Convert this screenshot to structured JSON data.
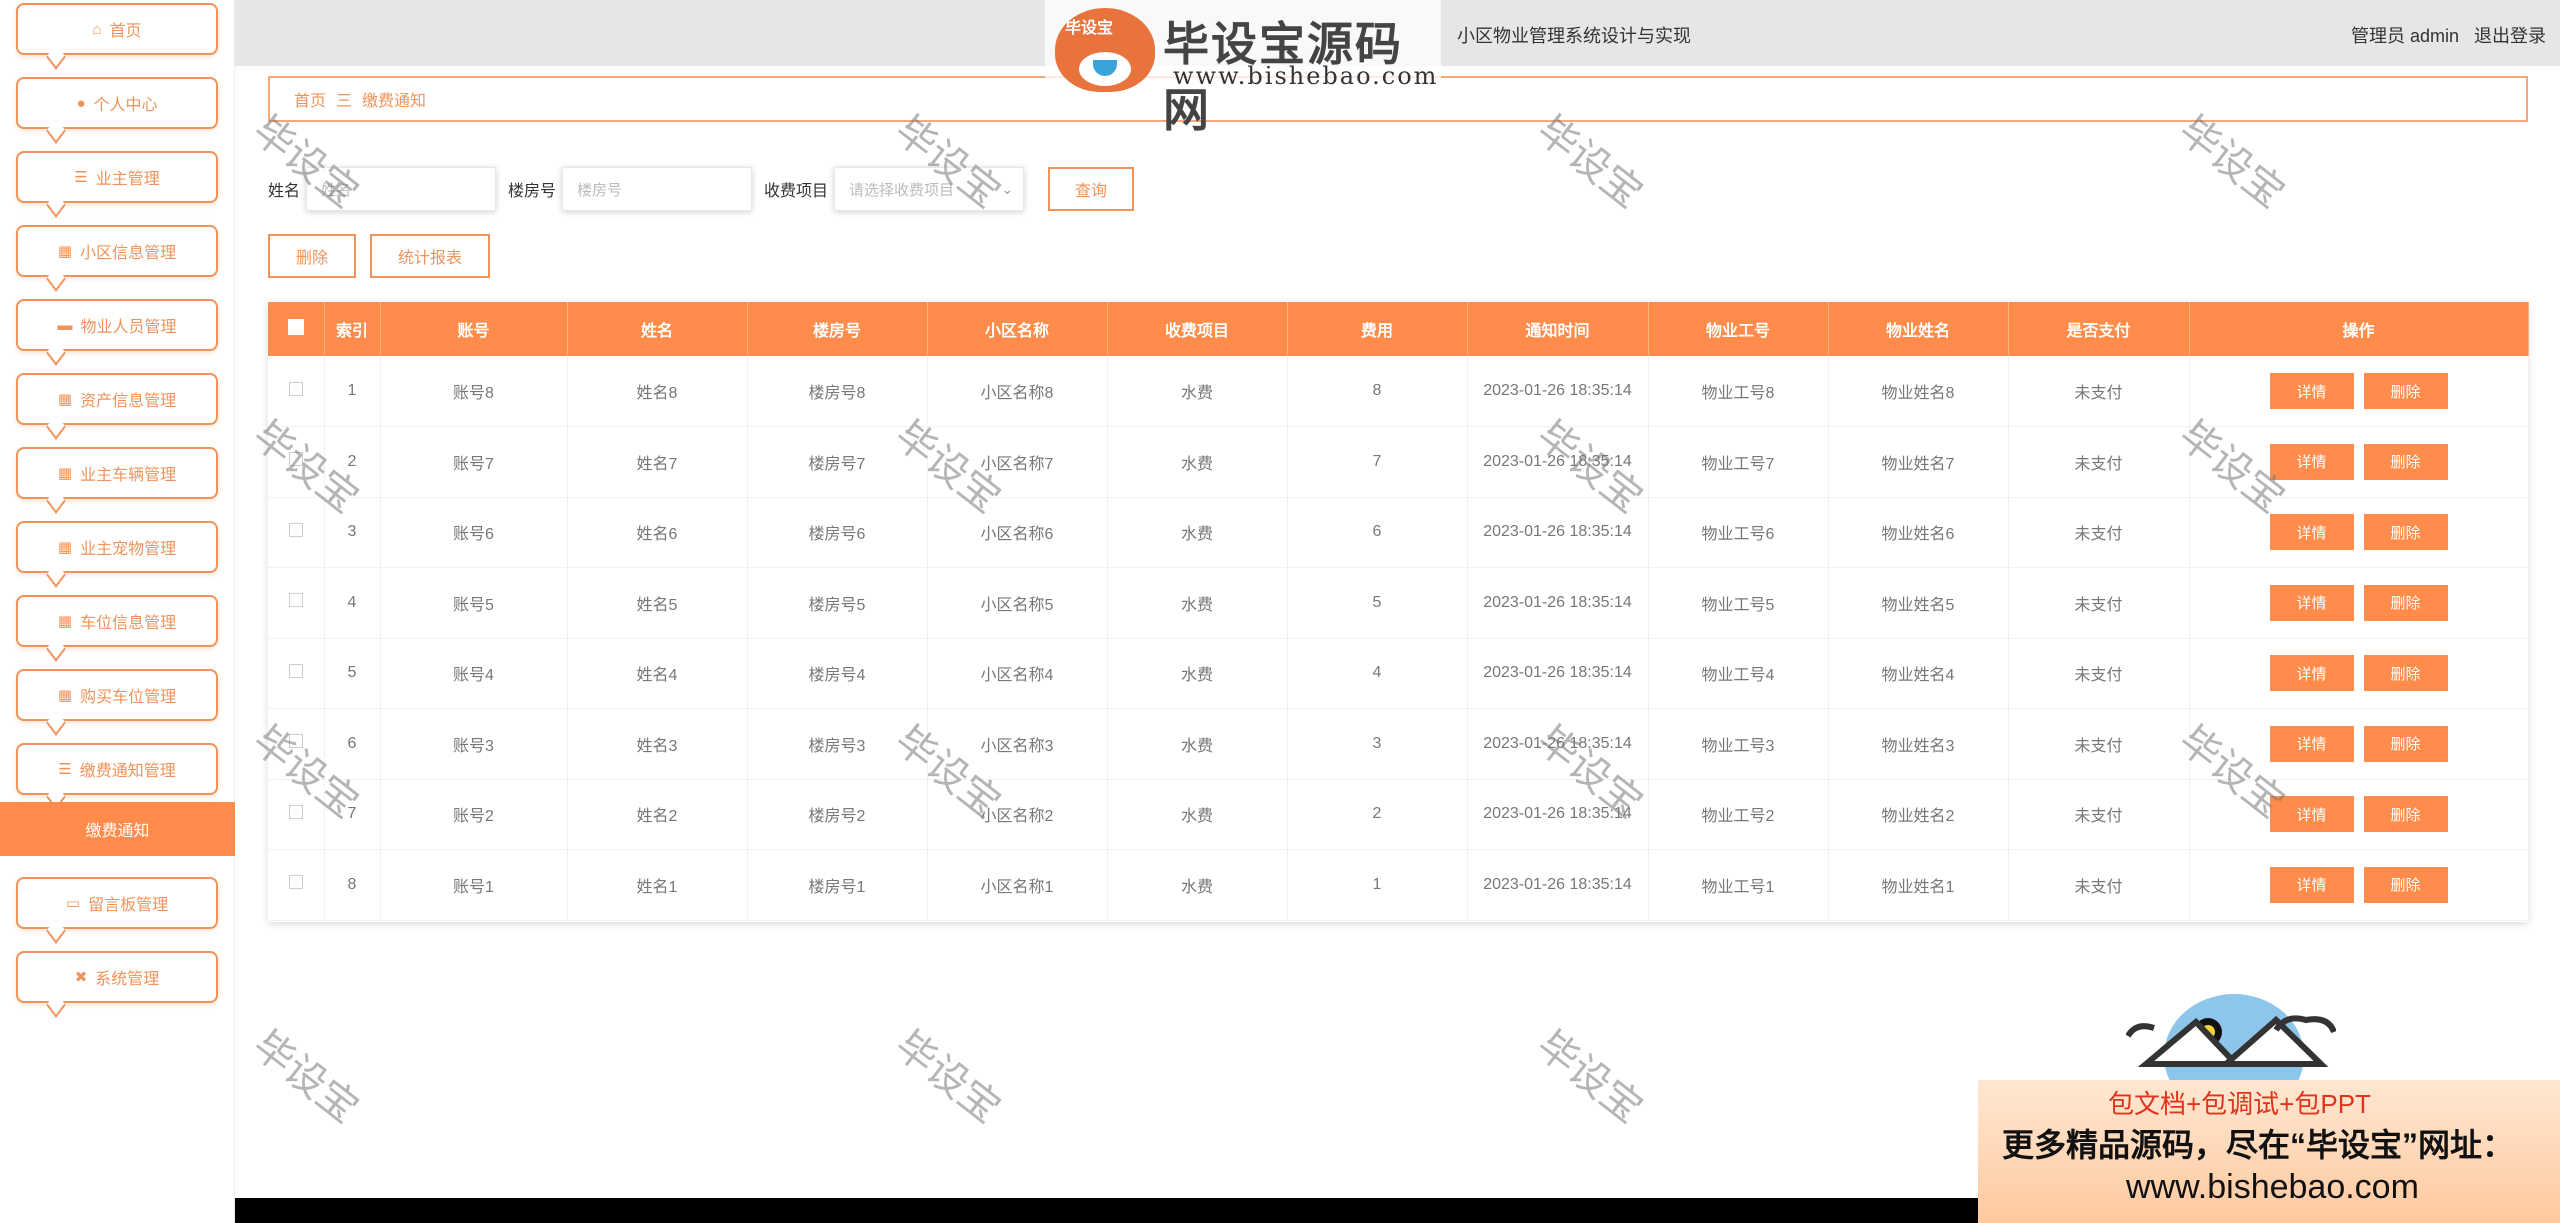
{
  "sidebar": {
    "items": [
      {
        "label": "首页",
        "icon": "home-icon",
        "glyph": "⌂"
      },
      {
        "label": "个人中心",
        "icon": "user-icon",
        "glyph": "●"
      },
      {
        "label": "业主管理",
        "icon": "list-icon",
        "glyph": "☰"
      },
      {
        "label": "小区信息管理",
        "icon": "grid-icon",
        "glyph": "▦"
      },
      {
        "label": "物业人员管理",
        "icon": "chair-icon",
        "glyph": "▬"
      },
      {
        "label": "资产信息管理",
        "icon": "grid-icon",
        "glyph": "▦"
      },
      {
        "label": "业主车辆管理",
        "icon": "grid-icon",
        "glyph": "▦"
      },
      {
        "label": "业主宠物管理",
        "icon": "grid-icon",
        "glyph": "▦"
      },
      {
        "label": "车位信息管理",
        "icon": "grid-icon",
        "glyph": "▦"
      },
      {
        "label": "购买车位管理",
        "icon": "apps-icon",
        "glyph": "▦"
      },
      {
        "label": "缴费通知管理",
        "icon": "sliders-icon",
        "glyph": "☰"
      },
      {
        "label": "留言板管理",
        "icon": "briefcase-icon",
        "glyph": "▭"
      },
      {
        "label": "系统管理",
        "icon": "ticket-icon",
        "glyph": "✖"
      }
    ],
    "active_sub": "缴费通知"
  },
  "header": {
    "title": "小区物业管理系统设计与实现",
    "user_label": "管理员 admin",
    "logout_label": "退出登录"
  },
  "breadcrumb": {
    "home": "首页",
    "separator": "三",
    "current": "缴费通知"
  },
  "search": {
    "name_label": "姓名",
    "name_placeholder": "姓名",
    "room_label": "楼房号",
    "room_placeholder": "楼房号",
    "item_label": "收费项目",
    "item_placeholder": "请选择收费项目",
    "search_button": "查询"
  },
  "actions": {
    "delete_button": "删除",
    "report_button": "统计报表"
  },
  "table": {
    "columns": [
      "索引",
      "账号",
      "姓名",
      "楼房号",
      "小区名称",
      "收费项目",
      "费用",
      "通知时间",
      "物业工号",
      "物业姓名",
      "是否支付",
      "操作"
    ],
    "detail_label": "详情",
    "delete_label": "删除",
    "rows": [
      {
        "index": "1",
        "account": "账号8",
        "name": "姓名8",
        "room": "楼房号8",
        "community": "小区名称8",
        "item": "水费",
        "fee": "8",
        "time": "2023-01-26 18:35:14",
        "staff_id": "物业工号8",
        "staff_name": "物业姓名8",
        "paid": "未支付"
      },
      {
        "index": "2",
        "account": "账号7",
        "name": "姓名7",
        "room": "楼房号7",
        "community": "小区名称7",
        "item": "水费",
        "fee": "7",
        "time": "2023-01-26 18:35:14",
        "staff_id": "物业工号7",
        "staff_name": "物业姓名7",
        "paid": "未支付"
      },
      {
        "index": "3",
        "account": "账号6",
        "name": "姓名6",
        "room": "楼房号6",
        "community": "小区名称6",
        "item": "水费",
        "fee": "6",
        "time": "2023-01-26 18:35:14",
        "staff_id": "物业工号6",
        "staff_name": "物业姓名6",
        "paid": "未支付"
      },
      {
        "index": "4",
        "account": "账号5",
        "name": "姓名5",
        "room": "楼房号5",
        "community": "小区名称5",
        "item": "水费",
        "fee": "5",
        "time": "2023-01-26 18:35:14",
        "staff_id": "物业工号5",
        "staff_name": "物业姓名5",
        "paid": "未支付"
      },
      {
        "index": "5",
        "account": "账号4",
        "name": "姓名4",
        "room": "楼房号4",
        "community": "小区名称4",
        "item": "水费",
        "fee": "4",
        "time": "2023-01-26 18:35:14",
        "staff_id": "物业工号4",
        "staff_name": "物业姓名4",
        "paid": "未支付"
      },
      {
        "index": "6",
        "account": "账号3",
        "name": "姓名3",
        "room": "楼房号3",
        "community": "小区名称3",
        "item": "水费",
        "fee": "3",
        "time": "2023-01-26 18:35:14",
        "staff_id": "物业工号3",
        "staff_name": "物业姓名3",
        "paid": "未支付"
      },
      {
        "index": "7",
        "account": "账号2",
        "name": "姓名2",
        "room": "楼房号2",
        "community": "小区名称2",
        "item": "水费",
        "fee": "2",
        "time": "2023-01-26 18:35:14",
        "staff_id": "物业工号2",
        "staff_name": "物业姓名2",
        "paid": "未支付"
      },
      {
        "index": "8",
        "account": "账号1",
        "name": "姓名1",
        "room": "楼房号1",
        "community": "小区名称1",
        "item": "水费",
        "fee": "1",
        "time": "2023-01-26 18:35:14",
        "staff_id": "物业工号1",
        "staff_name": "物业姓名1",
        "paid": "未支付"
      }
    ]
  },
  "watermark": {
    "text": "毕设宝",
    "logo_tag": "毕设宝",
    "logo_title": "毕设宝源码网",
    "logo_url": "www.bishebao.com"
  },
  "promo": {
    "line1": "包文档+包调试+包PPT",
    "line2": "更多精品源码，尽在“毕设宝”网址：",
    "line3": "www.bishebao.com"
  },
  "colors": {
    "accent": "#ff8c4b",
    "accent_border": "#f0935a",
    "header_bg": "#e6e6e6"
  }
}
